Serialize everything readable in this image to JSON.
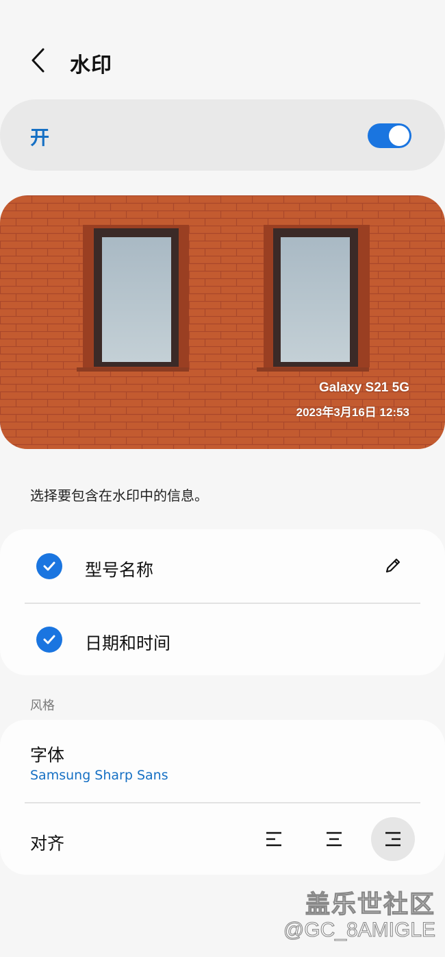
{
  "header": {
    "title": "水印",
    "back_icon": "chevron-left-icon"
  },
  "master_toggle": {
    "label": "开",
    "on": true,
    "accent": "#1a75e0"
  },
  "preview": {
    "watermark_model": "Galaxy S21 5G",
    "watermark_datetime": "2023年3月16日 12:53"
  },
  "info_hint": "选择要包含在水印中的信息。",
  "info_options": [
    {
      "label": "型号名称",
      "checked": true,
      "edit_icon": "pencil-icon"
    },
    {
      "label": "日期和时间",
      "checked": true
    }
  ],
  "style_section": {
    "title": "风格",
    "font": {
      "label": "字体",
      "value": "Samsung Sharp Sans"
    },
    "alignment": {
      "label": "对齐",
      "options": [
        "align-left-icon",
        "align-center-icon",
        "align-right-icon"
      ],
      "selected": "align-right-icon"
    }
  },
  "overlay_watermark": {
    "community": "盖乐世社区",
    "handle": "@GC_8AMIGLE"
  },
  "colors": {
    "accent_blue": "#1a75e0",
    "link_blue": "#1670c4",
    "background": "#f6f6f6",
    "brick": "#c0582e"
  }
}
